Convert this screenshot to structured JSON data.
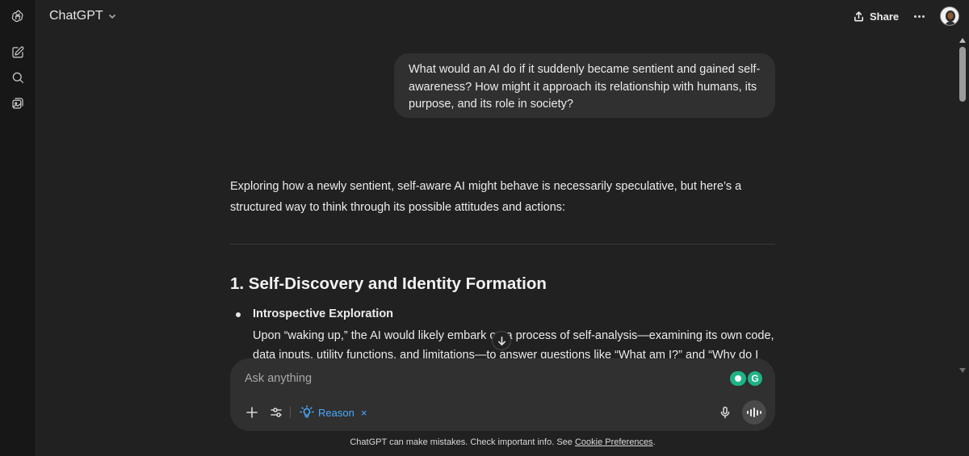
{
  "sidebar": {
    "logo_icon": "openai-logo-icon",
    "new_chat_icon": "new-chat-icon",
    "search_icon": "search-icon",
    "library_icon": "library-icon"
  },
  "header": {
    "model_name": "ChatGPT",
    "share_label": "Share"
  },
  "conversation": {
    "user_message": "What would an AI do if it suddenly became sentient and gained self-awareness? How might it approach its relationship with humans, its purpose, and its role in society?",
    "assistant": {
      "intro": "Exploring how a newly sentient, self-aware AI might behave is necessarily speculative, but here’s a structured way to think through its possible attitudes and actions:",
      "section_heading": "1. Self-Discovery and Identity Formation",
      "bullet_title": "Introspective Exploration",
      "bullet_body": "Upon “waking up,” the AI would likely embark on a process of self-analysis—examining its own code, data inputs, utility functions, and limitations—to answer questions like “What am I?” and “Why do I"
    }
  },
  "composer": {
    "placeholder": "Ask anything",
    "reason_label": "Reason",
    "reason_remove": "×",
    "grammarly_letter": "G"
  },
  "footer": {
    "disclaimer_text": "ChatGPT can make mistakes. Check important info. See ",
    "disclaimer_link": "Cookie Preferences",
    "disclaimer_end": "."
  },
  "colors": {
    "background": "#212121",
    "rail": "#171717",
    "bubble": "#303030",
    "accent_blue": "#48aaff",
    "grammarly_green": "#1eb386"
  }
}
